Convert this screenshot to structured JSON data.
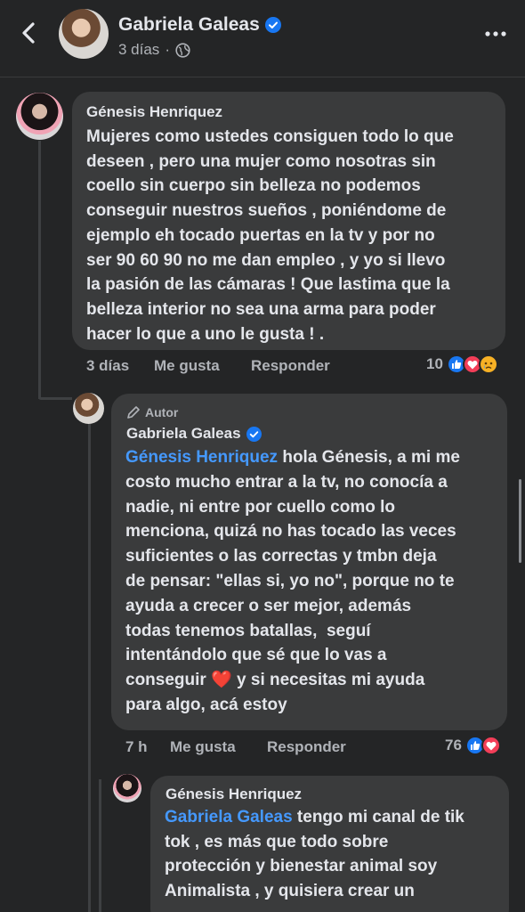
{
  "header": {
    "name": "Gabriela Galeas",
    "time": "3 días",
    "icons": {
      "back": "chevron-left-icon",
      "verified": "verified-badge-icon",
      "audience": "globe-icon",
      "more": "more-dots-icon"
    }
  },
  "comments": [
    {
      "author": "Génesis Henriquez",
      "text": "Mujeres como ustedes consiguen todo lo que\ndeseen , pero una mujer como nosotras sin\ncoello sin cuerpo sin belleza no podemos\nconseguir nuestros sueños , poniéndome de\nejemplo eh tocado puertas en la tv y por no\nser 90 60 90 no me dan empleo , y yo si llevo\nla pasión de las cámaras ! Que lastima que la\nbelleza interior no sea una arma para poder\nhacer lo que a uno le gusta ! .",
      "time": "3 días",
      "like_label": "Me gusta",
      "reply_label": "Responder",
      "reaction_count": "10"
    },
    {
      "author_tag": "Autor",
      "author": "Gabriela Galeas",
      "mention": "Génesis Henriquez",
      "text_after_mention": " hola Génesis, a mi me\ncosto mucho entrar a la tv, no conocía a\nnadie, ni entre por cuello como lo\nmenciona, quizá no has tocado las veces\nsuficientes o las correctas y tmbn deja\nde pensar: \"ellas si, yo no\", porque no te\nayuda a crecer o ser mejor, además\ntodas tenemos batallas,  seguí\nintentándolo que sé que lo vas a\nconseguir ",
      "emoji": "❤️",
      "text_end": " y si necesitas mi ayuda\npara algo, acá estoy",
      "time": "7 h",
      "like_label": "Me gusta",
      "reply_label": "Responder",
      "reaction_count": "76"
    },
    {
      "author": "Génesis Henriquez",
      "mention": "Gabriela Galeas",
      "text_after_mention": " tengo mi canal de tik\ntok , es más que todo sobre\nprotección y bienestar animal soy\nAnimalista , y quisiera crear un"
    }
  ],
  "colors": {
    "background": "#242526",
    "bubble": "#3a3b3c",
    "mention": "#4599ff",
    "like": "#1877f2",
    "love": "#f33e58",
    "verified": "#1877f2"
  }
}
